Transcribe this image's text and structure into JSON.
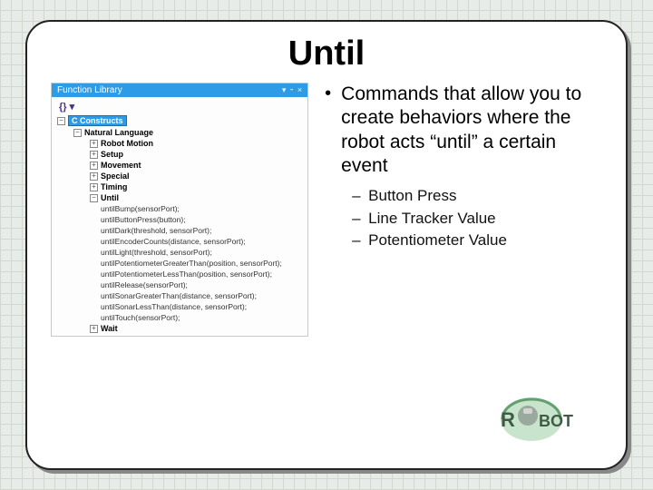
{
  "title": "Until",
  "panel": {
    "header": "Function Library",
    "brace": "{} ▾",
    "root_cat": "C Constructs",
    "cats": [
      "Natural Language",
      "Robot Motion",
      "Setup",
      "Movement",
      "Special",
      "Timing",
      "Until"
    ],
    "until_items": [
      "untilBump(sensorPort);",
      "untilButtonPress(button);",
      "untilDark(threshold, sensorPort);",
      "untilEncoderCounts(distance, sensorPort);",
      "untilLight(threshold, sensorPort);",
      "untilPotentiometerGreaterThan(position, sensorPort);",
      "untilPotentiometerLessThan(position, sensorPort);",
      "untilRelease(sensorPort);",
      "untilSonarGreaterThan(distance, sensorPort);",
      "untilSonarLessThan(distance, sensorPort);",
      "untilTouch(sensorPort);"
    ],
    "last_cat": "Wait"
  },
  "bullet_main": "Commands that allow you to create behaviors where the robot acts “until” a certain event",
  "sub_bullets": [
    "Button Press",
    "Line Tracker Value",
    "Potentiometer Value"
  ]
}
